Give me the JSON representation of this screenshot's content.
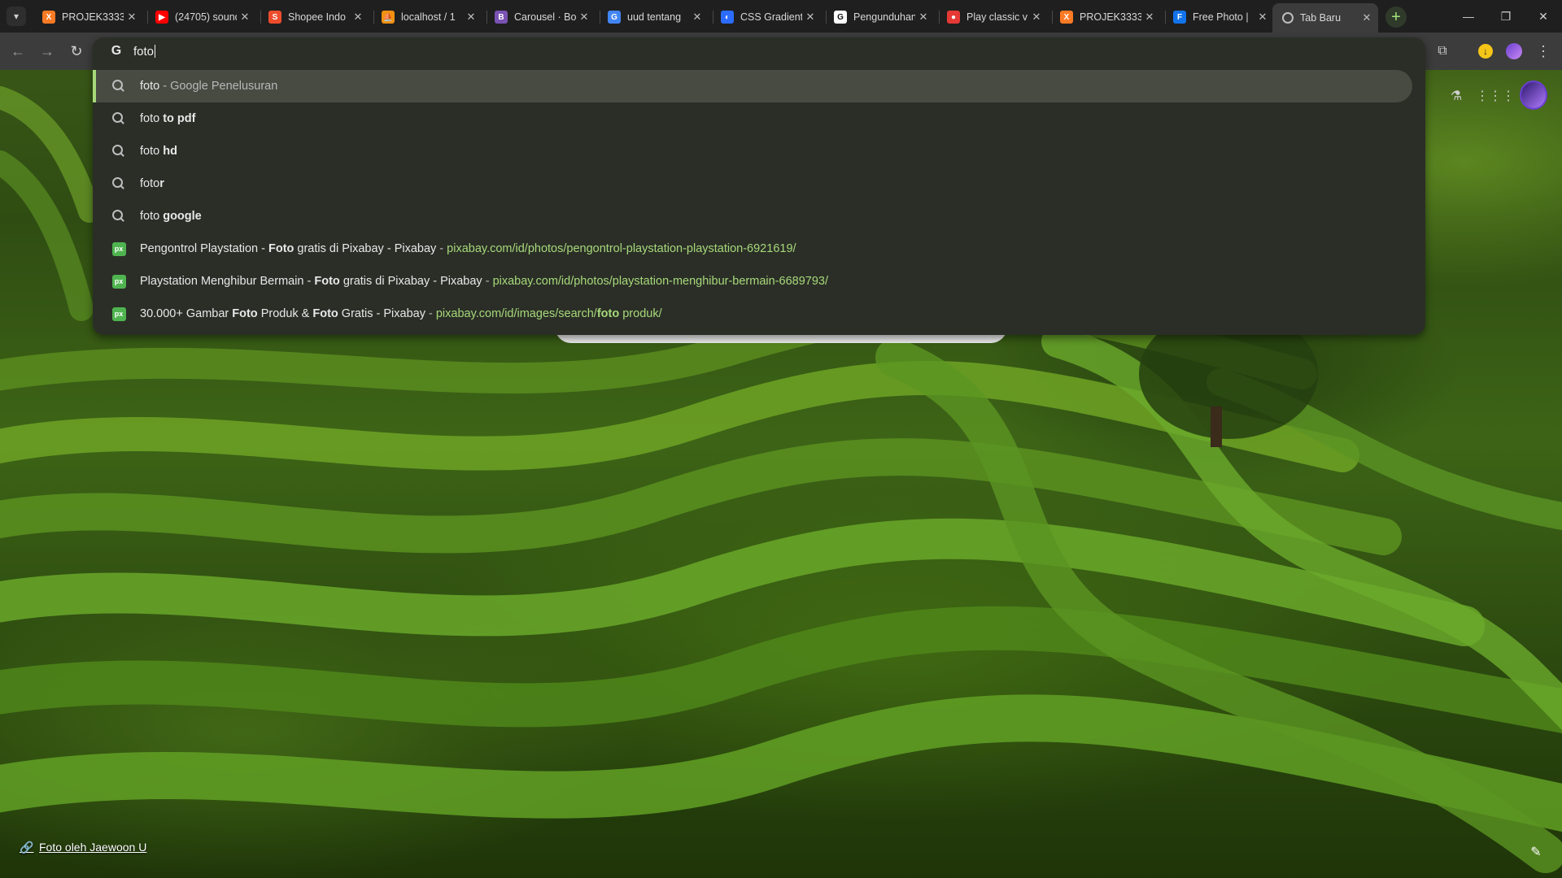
{
  "tabs": [
    {
      "title": "PROJEK3333",
      "favicon": "xampp-icon",
      "color": "#fb7a24"
    },
    {
      "title": "(24705) sound",
      "favicon": "youtube-icon",
      "color": "#ff0000"
    },
    {
      "title": "Shopee Indo",
      "favicon": "shopee-icon",
      "color": "#ee4d2d"
    },
    {
      "title": "localhost / 1",
      "favicon": "phpmyadmin-icon",
      "color": "#f29111"
    },
    {
      "title": "Carousel · Bo",
      "favicon": "bootstrap-icon",
      "color": "#7952b3"
    },
    {
      "title": "uud tentang",
      "favicon": "google-icon",
      "color": "#4285f4"
    },
    {
      "title": "CSS Gradient",
      "favicon": "css-gradient-icon",
      "color": "#2b6cff"
    },
    {
      "title": "Pengunduhan",
      "favicon": "github-icon",
      "color": "#d0d0d0"
    },
    {
      "title": "Play classic v",
      "favicon": "game-icon",
      "color": "#e53935"
    },
    {
      "title": "PROJEK3333",
      "favicon": "xampp-icon",
      "color": "#fb7a24"
    },
    {
      "title": "Free Photo |",
      "favicon": "freepik-icon",
      "color": "#1273eb"
    },
    {
      "title": "Tab Baru",
      "favicon": "chrome-icon",
      "color": "#bdbdbd"
    }
  ],
  "omnibox": {
    "query": "foto",
    "suggestions": [
      {
        "type": "search",
        "parts": [
          {
            "t": "foto",
            "s": "n"
          },
          {
            "t": " - Google Penelusuran",
            "s": "d"
          }
        ]
      },
      {
        "type": "search",
        "parts": [
          {
            "t": "foto ",
            "s": "n"
          },
          {
            "t": "to pdf",
            "s": "b"
          }
        ]
      },
      {
        "type": "search",
        "parts": [
          {
            "t": "foto ",
            "s": "n"
          },
          {
            "t": "hd",
            "s": "b"
          }
        ]
      },
      {
        "type": "search",
        "parts": [
          {
            "t": "foto",
            "s": "n"
          },
          {
            "t": "r",
            "s": "b"
          }
        ]
      },
      {
        "type": "search",
        "parts": [
          {
            "t": "foto ",
            "s": "n"
          },
          {
            "t": "google",
            "s": "b"
          }
        ]
      },
      {
        "type": "page",
        "parts": [
          {
            "t": "Pengontrol Playstation - ",
            "s": "n"
          },
          {
            "t": "Foto",
            "s": "b"
          },
          {
            "t": " gratis di Pixabay - Pixabay",
            "s": "n"
          },
          {
            "t": " - ",
            "s": "d"
          },
          {
            "t": "pixabay.com/id/photos/pengontrol-playstation-playstation-6921619/",
            "s": "u"
          }
        ]
      },
      {
        "type": "page",
        "parts": [
          {
            "t": "Playstation Menghibur Bermain - ",
            "s": "n"
          },
          {
            "t": "Foto",
            "s": "b"
          },
          {
            "t": " gratis di Pixabay - Pixabay",
            "s": "n"
          },
          {
            "t": " - ",
            "s": "d"
          },
          {
            "t": "pixabay.com/id/photos/playstation-menghibur-bermain-6689793/",
            "s": "u"
          }
        ]
      },
      {
        "type": "page",
        "parts": [
          {
            "t": "30.000+ Gambar ",
            "s": "n"
          },
          {
            "t": "Foto",
            "s": "b"
          },
          {
            "t": " Produk & ",
            "s": "n"
          },
          {
            "t": "Foto",
            "s": "b"
          },
          {
            "t": " Gratis - Pixabay",
            "s": "n"
          },
          {
            "t": " - ",
            "s": "d"
          },
          {
            "t": "pixabay.com/id/images/search/",
            "s": "u"
          },
          {
            "t": "foto",
            "s": "ub"
          },
          {
            "t": " produk/",
            "s": "u"
          }
        ]
      }
    ],
    "page_favicon_label": "px"
  },
  "footer": {
    "credit": "Foto oleh Jaewoon U"
  }
}
